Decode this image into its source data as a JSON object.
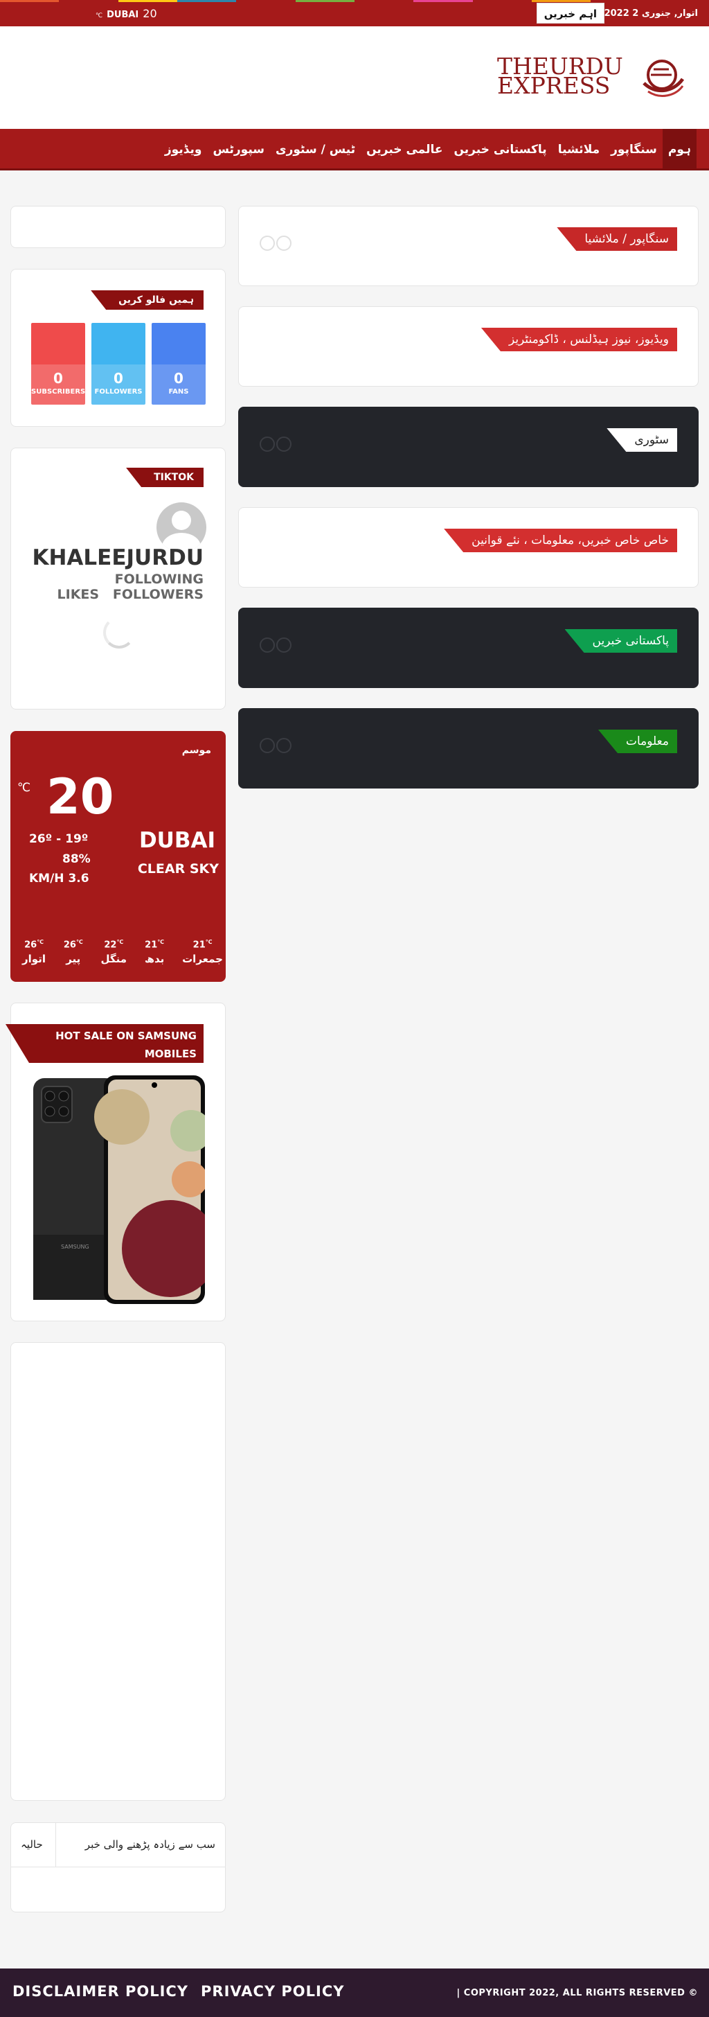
{
  "topbar": {
    "date": "اتوار, جنوری 2 2022",
    "breaking_label": "اہم خبریں",
    "weather": {
      "temp": "20",
      "unit": "℃",
      "city": "DUBAI"
    },
    "stripe_colors": [
      "#e4572e",
      "#a51a1a",
      "#ffc914",
      "#2e86ab",
      "#a51a1a",
      "#76b041",
      "#a51a1a",
      "#e84393",
      "#a51a1a",
      "#f39c12",
      "#a51a1a",
      "#a51a1a"
    ]
  },
  "header": {
    "logo_line1": "THEURDU",
    "logo_line2": "EXPRESS",
    "logo_icon": "swirl-globe-icon"
  },
  "nav": {
    "items": [
      "ہوم",
      "سنگاپور",
      "ملائشیا",
      "پاکستانی خبریں",
      "عالمی خبریں",
      "ٹیس / سٹوری",
      "سپورٹس",
      "ویڈیوز"
    ]
  },
  "main": {
    "blocks": [
      {
        "title": "سنگاپور / ملائشیا",
        "color": "#c62828",
        "dark": false
      },
      {
        "title": "ویڈیوز، نیوز ہیڈلنس ، ڈاکومنٹریز",
        "color": "#d32f2f",
        "dark": false
      },
      {
        "title": "سٹوری",
        "color": "#ffffff",
        "dark": true
      },
      {
        "title": "خاص خاص خبریں، معلومات ، نئے قوانین",
        "color": "#d32f2f",
        "dark": false
      },
      {
        "title": "پاکستانی خبریں",
        "color": "#0e9f4f",
        "dark": true
      },
      {
        "title": "معلومات",
        "color": "#1a8a1a",
        "dark": true
      }
    ]
  },
  "sidebar": {
    "follow": {
      "title": "ہمیں فالو کریں",
      "items": [
        {
          "name": "youtube",
          "count": "0",
          "label": "SUBSCRIBERS",
          "color": "#ef4b4b"
        },
        {
          "name": "twitter",
          "count": "0",
          "label": "FOLLOWERS",
          "color": "#40b4f0"
        },
        {
          "name": "facebook",
          "count": "0",
          "label": "FANS",
          "color": "#4a82f0"
        }
      ]
    },
    "tiktok": {
      "title": "TIKTOK",
      "username": "KHALEEJURDU",
      "following": "FOLLOWING",
      "likes_followers": "LIKES   FOLLOWERS"
    },
    "weather": {
      "title": "موسم",
      "unit": "℃",
      "temp": "20",
      "city": "DUBAI",
      "desc": "CLEAR SKY",
      "range": "26º - 19º",
      "humidity": "88%",
      "wind": "KM/H 3.6",
      "days": [
        {
          "temp": "26",
          "name": "اتوار"
        },
        {
          "temp": "26",
          "name": "پیر"
        },
        {
          "temp": "22",
          "name": "منگل"
        },
        {
          "temp": "21",
          "name": "بدھ"
        },
        {
          "temp": "21",
          "name": "جمعرات"
        }
      ],
      "day_unit": "℃"
    },
    "promo": {
      "title_line1": "HOT SALE ON SAMSUNG",
      "title_line2": "MOBILES",
      "brand": "SAMSUNG"
    },
    "tabs": [
      "سب سے زیادہ پڑھنے والی خبر",
      "حالیہ"
    ]
  },
  "footer": {
    "links": [
      "DISCLAIMER POLICY",
      "PRIVACY POLICY"
    ],
    "copyright": "| COPYRIGHT 2022, ALL RIGHTS RESERVED ©"
  }
}
